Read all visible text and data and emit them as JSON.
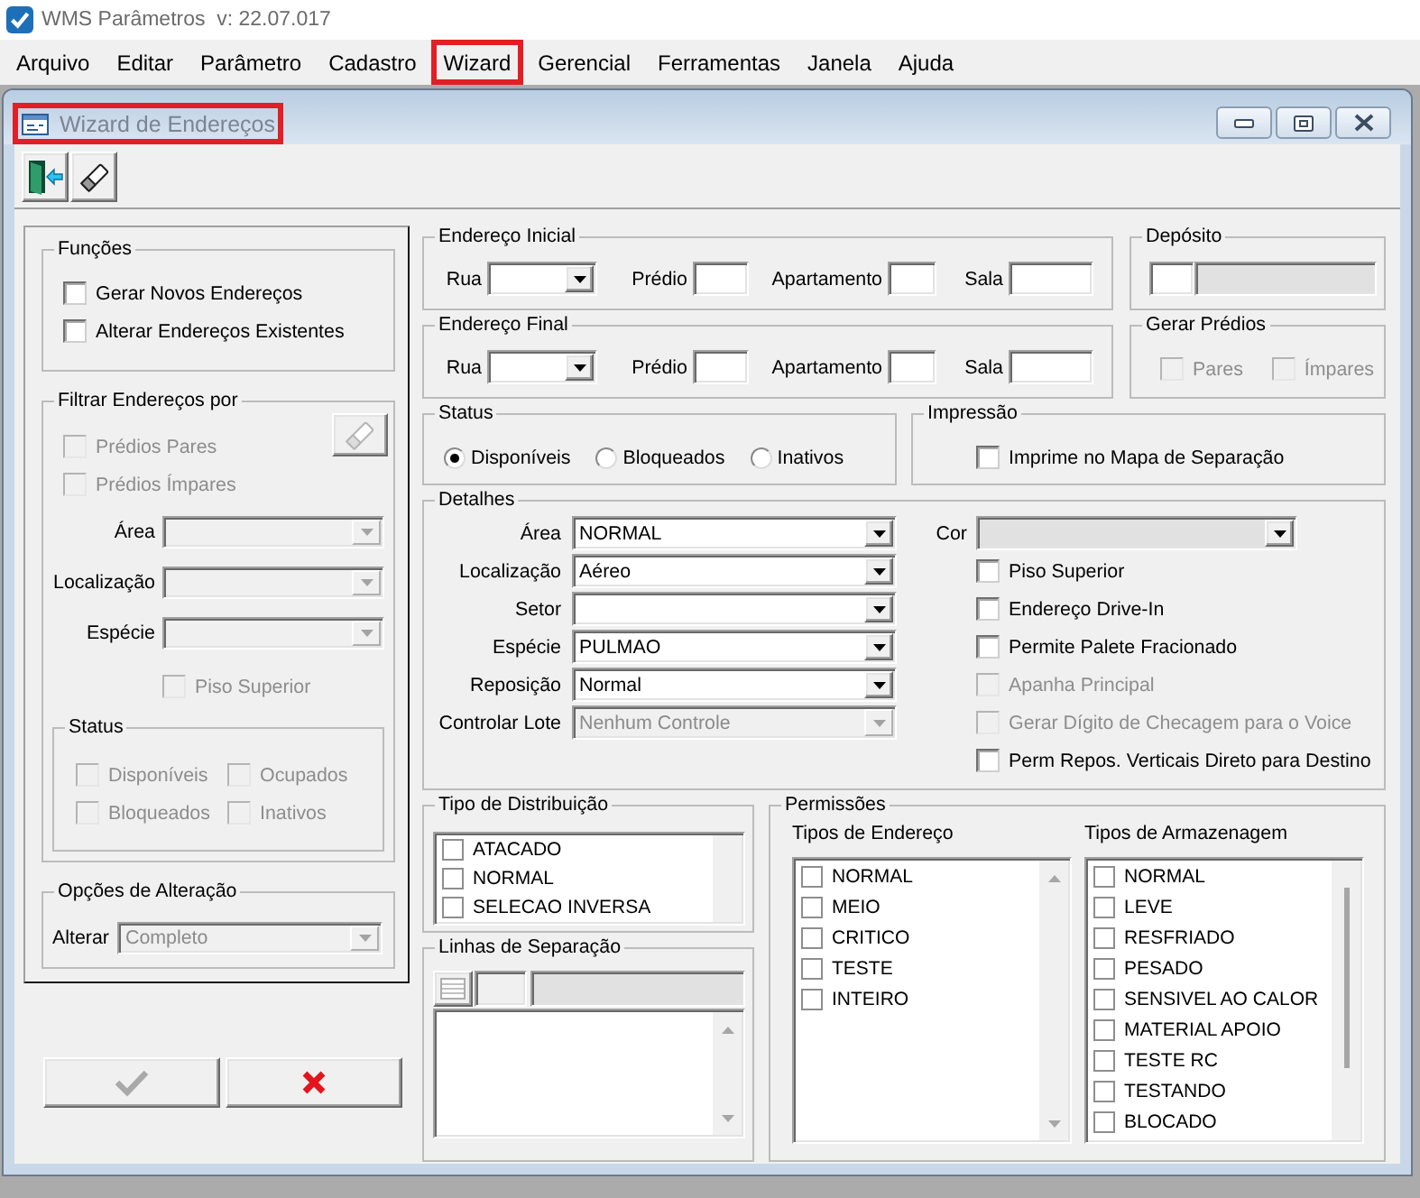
{
  "app": {
    "title": "WMS Parâmetros  v: 22.07.017"
  },
  "menu": [
    {
      "label": "Arquivo",
      "highlighted": false
    },
    {
      "label": "Editar",
      "highlighted": false
    },
    {
      "label": "Parâmetro",
      "highlighted": false
    },
    {
      "label": "Cadastro",
      "highlighted": false
    },
    {
      "label": "Wizard",
      "highlighted": true
    },
    {
      "label": "Gerencial",
      "highlighted": false
    },
    {
      "label": "Ferramentas",
      "highlighted": false
    },
    {
      "label": "Janela",
      "highlighted": false
    },
    {
      "label": "Ajuda",
      "highlighted": false
    }
  ],
  "child_window": {
    "title": "Wizard de Endereços",
    "highlighted": true
  },
  "functions": {
    "title": "Funções",
    "options": [
      {
        "label": "Gerar Novos Endereços",
        "checked": false,
        "disabled": false
      },
      {
        "label": "Alterar Endereços Existentes",
        "checked": false,
        "disabled": false
      }
    ]
  },
  "filter": {
    "title": "Filtrar Endereços por",
    "options": [
      {
        "label": "Prédios Pares",
        "checked": false,
        "disabled": true
      },
      {
        "label": "Prédios Ímpares",
        "checked": false,
        "disabled": true
      }
    ],
    "eraser_button": {
      "disabled": true
    },
    "fields": [
      {
        "label": "Área",
        "disabled": true
      },
      {
        "label": "Localização",
        "disabled": true
      },
      {
        "label": "Espécie",
        "disabled": true
      }
    ],
    "upper_floor": {
      "label": "Piso Superior",
      "checked": false,
      "disabled": true
    },
    "status": {
      "title": "Status",
      "options": [
        {
          "label": "Disponíveis",
          "checked": false,
          "disabled": true
        },
        {
          "label": "Ocupados",
          "checked": false,
          "disabled": true
        },
        {
          "label": "Bloqueados",
          "checked": false,
          "disabled": true
        },
        {
          "label": "Inativos",
          "checked": false,
          "disabled": true
        }
      ]
    }
  },
  "change_options": {
    "title": "Opções de Alteração",
    "label": "Alterar",
    "value": "Completo",
    "disabled": true
  },
  "buttons": [
    {
      "kind": "confirm",
      "disabled": true
    },
    {
      "kind": "cancel",
      "disabled": false
    }
  ],
  "initial_address": {
    "title": "Endereço Inicial",
    "fields": [
      {
        "label": "Rua",
        "kind": "dropdown"
      },
      {
        "label": "Prédio",
        "kind": "text"
      },
      {
        "label": "Apartamento",
        "kind": "text"
      },
      {
        "label": "Sala",
        "kind": "text"
      }
    ]
  },
  "depot": {
    "title": "Depósito"
  },
  "final_address": {
    "title": "Endereço Final",
    "fields": [
      {
        "label": "Rua",
        "kind": "dropdown"
      },
      {
        "label": "Prédio",
        "kind": "text"
      },
      {
        "label": "Apartamento",
        "kind": "text"
      },
      {
        "label": "Sala",
        "kind": "text"
      }
    ]
  },
  "generate_buildings": {
    "title": "Gerar Prédios",
    "options": [
      {
        "label": "Pares",
        "checked": false,
        "disabled": true
      },
      {
        "label": "Ímpares",
        "checked": false,
        "disabled": true
      }
    ]
  },
  "status": {
    "title": "Status",
    "options": [
      {
        "label": "Disponíveis",
        "selected": true
      },
      {
        "label": "Bloqueados",
        "selected": false
      },
      {
        "label": "Inativos",
        "selected": false
      }
    ]
  },
  "printing": {
    "title": "Impressão",
    "options": [
      {
        "label": "Imprime no Mapa de Separação",
        "checked": false,
        "disabled": false
      }
    ]
  },
  "details": {
    "title": "Detalhes",
    "fields": [
      {
        "label": "Área",
        "value": "NORMAL",
        "disabled": false
      },
      {
        "label": "Localização",
        "value": "Aéreo",
        "disabled": false
      },
      {
        "label": "Setor",
        "disabled": false
      },
      {
        "label": "Espécie",
        "value": "PULMAO",
        "disabled": false
      },
      {
        "label": "Reposição",
        "value": "Normal",
        "disabled": false
      },
      {
        "label": "Controlar Lote",
        "value": "Nenhum Controle",
        "disabled": true
      }
    ],
    "color": {
      "label": "Cor"
    },
    "options": [
      {
        "label": "Piso Superior",
        "checked": false,
        "disabled": false
      },
      {
        "label": "Endereço Drive-In",
        "checked": false,
        "disabled": false
      },
      {
        "label": "Permite Palete Fracionado",
        "checked": false,
        "disabled": false
      },
      {
        "label": "Apanha Principal",
        "checked": false,
        "disabled": true
      },
      {
        "label": "Gerar Dígito de Checagem para o Voice",
        "checked": false,
        "disabled": true
      },
      {
        "label": "Perm Repos. Verticais Direto para Destino",
        "checked": false,
        "disabled": false
      }
    ]
  },
  "distribution": {
    "title": "Tipo de Distribuição",
    "items": [
      {
        "label": "ATACADO",
        "checked": false
      },
      {
        "label": "NORMAL",
        "checked": false
      },
      {
        "label": "SELECAO INVERSA",
        "checked": false
      }
    ]
  },
  "separation_lines": {
    "title": "Linhas de Separação"
  },
  "permissions": {
    "title": "Permissões",
    "lists": [
      {
        "title": "Tipos de Endereço",
        "items": [
          {
            "label": "NORMAL",
            "checked": false
          },
          {
            "label": "MEIO",
            "checked": false
          },
          {
            "label": "CRITICO",
            "checked": false
          },
          {
            "label": "TESTE",
            "checked": false
          },
          {
            "label": "INTEIRO",
            "checked": false
          }
        ]
      },
      {
        "title": "Tipos de Armazenagem",
        "items": [
          {
            "label": "NORMAL",
            "checked": false
          },
          {
            "label": "LEVE",
            "checked": false
          },
          {
            "label": "RESFRIADO",
            "checked": false
          },
          {
            "label": "PESADO",
            "checked": false
          },
          {
            "label": "SENSIVEL AO CALOR",
            "checked": false
          },
          {
            "label": "MATERIAL APOIO",
            "checked": false
          },
          {
            "label": "TESTE RC",
            "checked": false
          },
          {
            "label": "TESTANDO",
            "checked": false
          },
          {
            "label": "BLOCADO",
            "checked": false
          }
        ]
      }
    ]
  }
}
